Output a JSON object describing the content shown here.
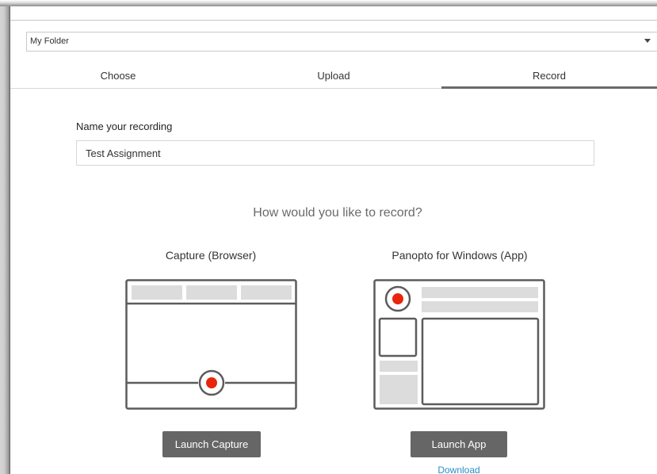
{
  "folder": {
    "value": "My Folder"
  },
  "tabs": [
    {
      "label": "Choose",
      "active": false
    },
    {
      "label": "Upload",
      "active": false
    },
    {
      "label": "Record",
      "active": true
    }
  ],
  "recording": {
    "name_label": "Name your recording",
    "name_value": "Test Assignment"
  },
  "question": "How would you like to record?",
  "options": {
    "capture": {
      "title": "Capture (Browser)",
      "button": "Launch Capture"
    },
    "app": {
      "title": "Panopto for Windows (App)",
      "button": "Launch App",
      "download": "Download"
    }
  },
  "colors": {
    "record_dot": "#e8260c",
    "button_bg": "#666666",
    "link": "#2a8fc9",
    "active_tab_underline": "#6b6b6b"
  }
}
